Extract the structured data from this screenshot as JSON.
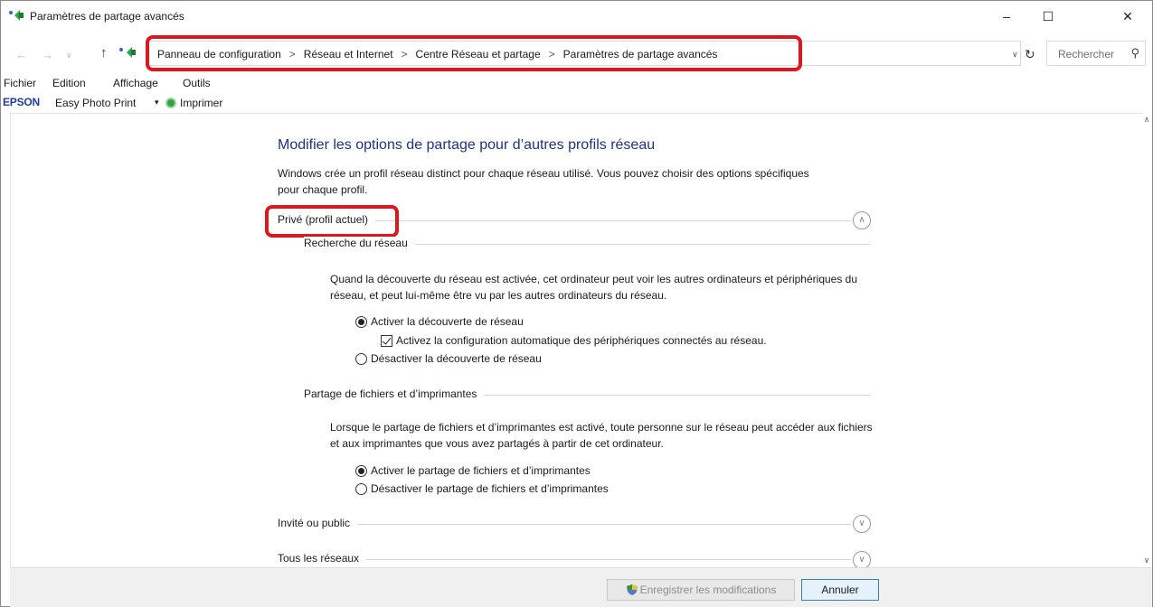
{
  "window": {
    "title": "Paramètres de partage avancés",
    "controls": [
      "–",
      "☐",
      "✕"
    ]
  },
  "address_bar": {
    "crumbs": [
      "Panneau de configuration",
      "Réseau et Internet",
      "Centre Réseau et partage",
      "Paramètres de partage avancés"
    ],
    "separator": ">",
    "search_placeholder": "Rechercher"
  },
  "menu": {
    "items": [
      "Fichier",
      "Edition",
      "Affichage",
      "Outils"
    ]
  },
  "epson_bar": {
    "logo": "EPSON",
    "app": "Easy Photo Print",
    "caret": "▾",
    "print_label": "Imprimer"
  },
  "page": {
    "heading": "Modifier les options de partage pour d’autres profils réseau",
    "intro": "Windows crée un profil réseau distinct pour chaque réseau utilisé. Vous pouvez choisir des options spécifiques pour chaque profil.",
    "profile_private": {
      "label": "Privé (profil actuel)",
      "expanded": true,
      "network_discovery": {
        "label": "Recherche du réseau",
        "description": "Quand la découverte du réseau est activée, cet ordinateur peut voir les autres ordinateurs et périphériques du réseau, et peut lui-même être vu par les autres ordinateurs du réseau.",
        "option_on": "Activer la découverte de réseau",
        "option_auto": "Activez la configuration automatique des périphériques connectés au réseau.",
        "option_off": "Désactiver la découverte de réseau",
        "selected": "on",
        "auto_checked": true
      },
      "file_sharing": {
        "label": "Partage de fichiers et d’imprimantes",
        "description": "Lorsque le partage de fichiers et d’imprimantes est activé, toute personne sur le réseau peut accéder aux fichiers et aux imprimantes que vous avez partagés à partir de cet ordinateur.",
        "option_on": "Activer le partage de fichiers et d’imprimantes",
        "option_off": "Désactiver le partage de fichiers et d’imprimantes",
        "selected": "on"
      }
    },
    "profile_guest": {
      "label": "Invité ou public",
      "expanded": false
    },
    "profile_all": {
      "label": "Tous les réseaux",
      "expanded": false
    }
  },
  "buttons": {
    "save": "Enregistrer les modifications",
    "cancel": "Annuler"
  },
  "colors": {
    "heading": "#1e3287",
    "highlight": "#e2141c",
    "epson": "#1f3da0"
  }
}
